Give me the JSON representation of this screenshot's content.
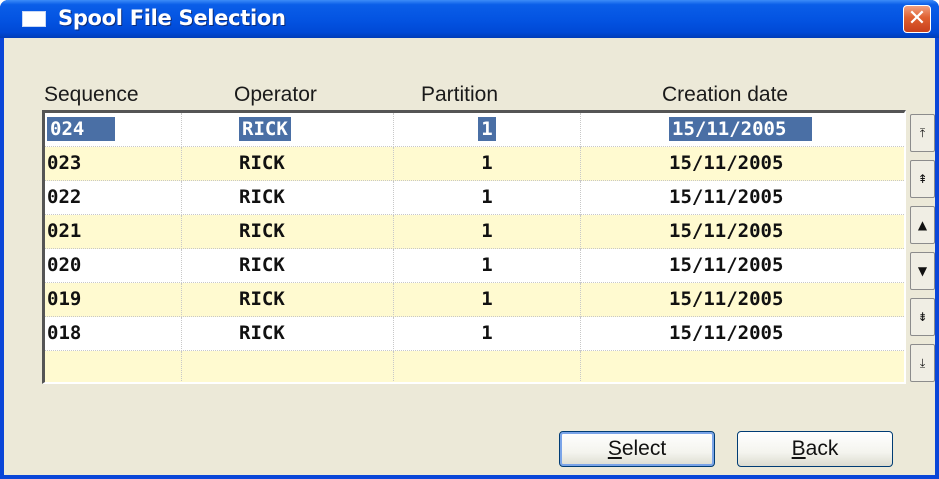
{
  "window": {
    "title": "Spool File Selection",
    "close_glyph": "✕",
    "icon": "window-icon"
  },
  "columns": [
    "Sequence",
    "Operator",
    "Partition",
    "Creation date"
  ],
  "rows": [
    {
      "sequence": "024",
      "operator": "RICK",
      "partition": "1",
      "creation_date": "15/11/2005",
      "selected": true
    },
    {
      "sequence": "023",
      "operator": "RICK",
      "partition": "1",
      "creation_date": "15/11/2005",
      "selected": false
    },
    {
      "sequence": "022",
      "operator": "RICK",
      "partition": "1",
      "creation_date": "15/11/2005",
      "selected": false
    },
    {
      "sequence": "021",
      "operator": "RICK",
      "partition": "1",
      "creation_date": "15/11/2005",
      "selected": false
    },
    {
      "sequence": "020",
      "operator": "RICK",
      "partition": "1",
      "creation_date": "15/11/2005",
      "selected": false
    },
    {
      "sequence": "019",
      "operator": "RICK",
      "partition": "1",
      "creation_date": "15/11/2005",
      "selected": false
    },
    {
      "sequence": "018",
      "operator": "RICK",
      "partition": "1",
      "creation_date": "15/11/2005",
      "selected": false
    }
  ],
  "scroll_buttons": [
    {
      "name": "scroll-first-icon",
      "glyph": "⤒"
    },
    {
      "name": "scroll-page-up-icon",
      "glyph": "⇞"
    },
    {
      "name": "scroll-up-icon",
      "glyph": "▲"
    },
    {
      "name": "scroll-down-icon",
      "glyph": "▼"
    },
    {
      "name": "scroll-page-down-icon",
      "glyph": "⇟"
    },
    {
      "name": "scroll-last-icon",
      "glyph": "⤓"
    }
  ],
  "buttons": {
    "select": {
      "mnemonic": "S",
      "rest": "elect"
    },
    "back": {
      "mnemonic": "B",
      "rest": "ack"
    }
  },
  "colors": {
    "title_bar": "#0454e2",
    "selection": "#4a6fa5",
    "row_alt": "#fffad0",
    "dialog_bg": "#ece9d8"
  }
}
